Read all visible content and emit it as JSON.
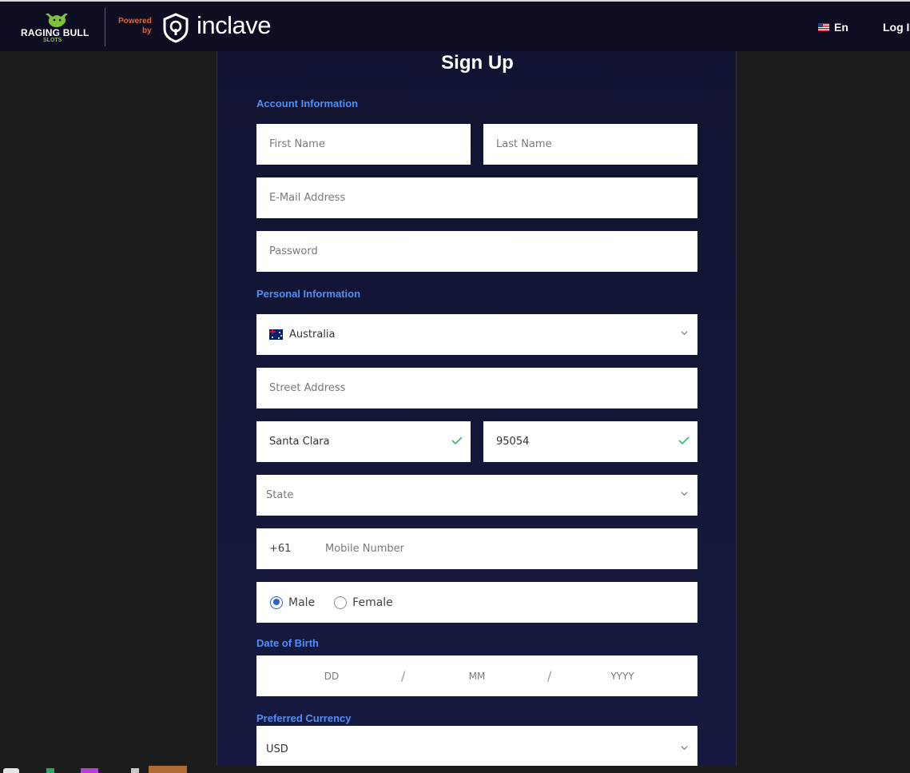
{
  "header": {
    "brand_name": "RAGING BULL",
    "brand_sub": "SLOTS",
    "powered_line1": "Powered",
    "powered_line2": "by",
    "partner_name": "inclave",
    "language_label": "En",
    "login_label": "Log In"
  },
  "form": {
    "title": "Sign Up",
    "account_section": "Account Information",
    "first_name_placeholder": "First Name",
    "last_name_placeholder": "Last Name",
    "email_placeholder": "E-Mail Address",
    "password_placeholder": "Password",
    "personal_section": "Personal Information",
    "country_value": "Australia",
    "street_placeholder": "Street Address",
    "city_value": "Santa Clara",
    "zip_value": "95054",
    "state_placeholder": "State",
    "phone_prefix": "+61",
    "mobile_placeholder": "Mobile Number",
    "gender_options": [
      "Male",
      "Female"
    ],
    "gender_selected": "Male",
    "dob_section": "Date of Birth",
    "dob_day_placeholder": "DD",
    "dob_month_placeholder": "MM",
    "dob_year_placeholder": "YYYY",
    "dob_separator": "/",
    "currency_section": "Preferred Currency",
    "currency_value": "USD"
  },
  "colors": {
    "header_bg": "#0d0e22",
    "card_bg": "#111331",
    "section_label": "#4f8ff7",
    "partner_accent": "#e7632a",
    "valid_check": "#2ec06b",
    "radio_selected": "#2e63c9"
  },
  "icons": [
    "bull-icon",
    "inclave-shield-icon",
    "us-flag-icon",
    "australia-flag-icon",
    "chevron-down-icon",
    "check-icon"
  ]
}
